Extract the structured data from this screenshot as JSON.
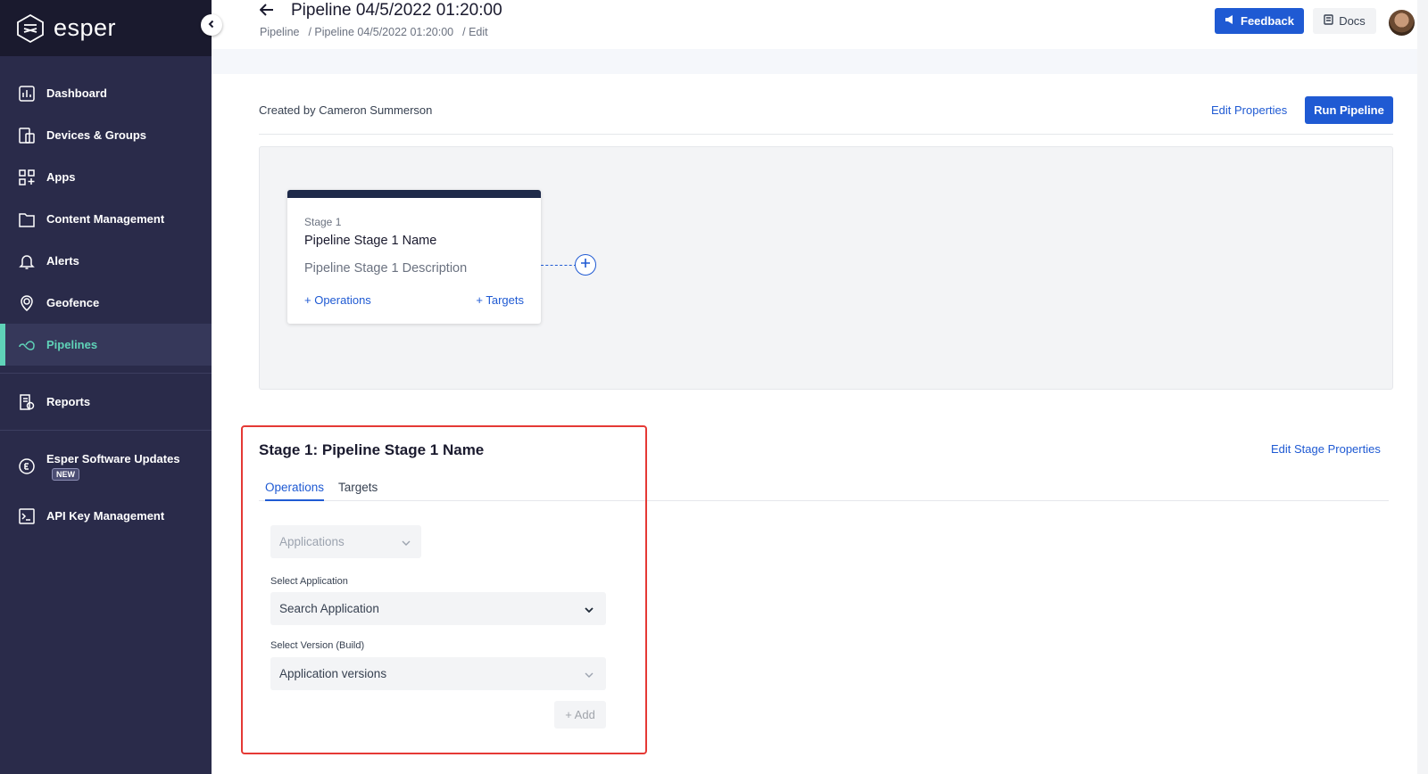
{
  "brand": {
    "name": "esper"
  },
  "sidebar": {
    "items": [
      {
        "label": "Dashboard",
        "icon": "dashboard-icon"
      },
      {
        "label": "Devices & Groups",
        "icon": "devices-icon"
      },
      {
        "label": "Apps",
        "icon": "apps-icon"
      },
      {
        "label": "Content Management",
        "icon": "folder-icon"
      },
      {
        "label": "Alerts",
        "icon": "bell-icon"
      },
      {
        "label": "Geofence",
        "icon": "geofence-icon"
      },
      {
        "label": "Pipelines",
        "icon": "pipeline-icon",
        "active": true
      },
      {
        "label": "Reports",
        "icon": "reports-icon"
      },
      {
        "label": "Esper Software Updates",
        "icon": "esper-updates-icon",
        "badge": "NEW"
      },
      {
        "label": "API Key Management",
        "icon": "terminal-icon"
      }
    ]
  },
  "header": {
    "title": "Pipeline 04/5/2022 01:20:00",
    "breadcrumb": [
      "Pipeline",
      "/ Pipeline 04/5/2022 01:20:00",
      "/ Edit"
    ],
    "feedback_label": "Feedback",
    "docs_label": "Docs"
  },
  "pipeline": {
    "created_by": "Created by Cameron Summerson",
    "edit_properties_label": "Edit Properties",
    "run_label": "Run Pipeline"
  },
  "stage_card": {
    "label": "Stage 1",
    "name": "Pipeline Stage 1 Name",
    "description": "Pipeline Stage 1 Description",
    "operations_link": "+ Operations",
    "targets_link": "+ Targets"
  },
  "stage_detail": {
    "heading": "Stage 1: Pipeline Stage 1 Name",
    "edit_stage_label": "Edit Stage Properties",
    "tabs": [
      "Operations",
      "Targets"
    ],
    "operation_type": {
      "value": "Applications"
    },
    "select_application": {
      "label": "Select Application",
      "placeholder": "Search Application"
    },
    "select_version": {
      "label": "Select Version (Build)",
      "placeholder": "Application versions"
    },
    "add_label": "+ Add"
  },
  "colors": {
    "sidebar_bg": "#2a2b4a",
    "accent_blue": "#1f5ad3",
    "active_green": "#5fd3b8",
    "highlight_red": "#e53935"
  }
}
